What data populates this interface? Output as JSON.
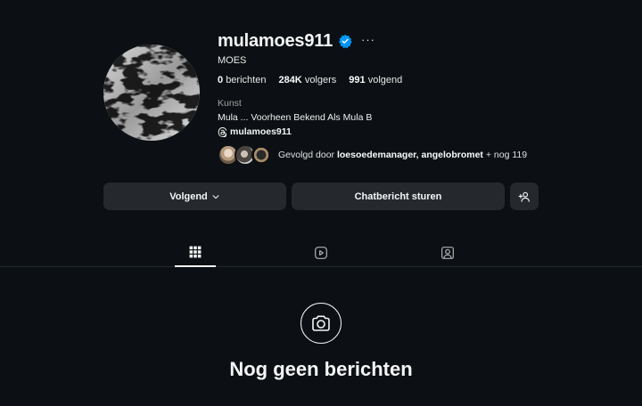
{
  "profile": {
    "username": "mulamoes911",
    "more_label": "···",
    "full_name": "MOES",
    "stats": {
      "posts_count": "0",
      "posts_label": "berichten",
      "followers_count": "284K",
      "followers_label": "volgers",
      "following_count": "991",
      "following_label": "volgend"
    },
    "category": "Kunst",
    "bio": "Mula ... Voorheen Bekend Als Mula B",
    "threads_handle": "mulamoes911",
    "followed_by": {
      "prefix": "Gevolgd door",
      "names": "loesoedemanager, angelobromet",
      "suffix": "+ nog 119"
    }
  },
  "actions": {
    "follow_label": "Volgend",
    "chat_label": "Chatbericht sturen"
  },
  "tabs": [
    {
      "icon": "grid-icon",
      "active": true
    },
    {
      "icon": "reels-icon",
      "active": false
    },
    {
      "icon": "tagged-icon",
      "active": false
    }
  ],
  "empty_state": {
    "icon": "camera-icon",
    "title": "Nog geen berichten"
  },
  "colors": {
    "background": "#0c1014",
    "button": "#25292e",
    "verified": "#0095f6",
    "text": "#f5f5f5",
    "muted": "#a0a0a0"
  }
}
